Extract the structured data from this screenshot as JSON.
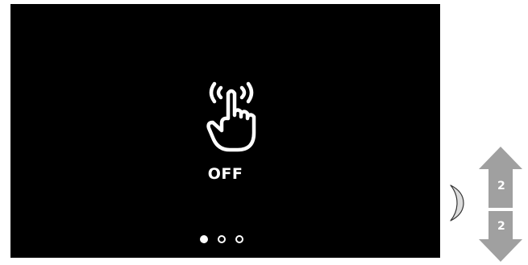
{
  "screen": {
    "status": "OFF",
    "icon": "touch-hand-icon",
    "pager": {
      "total": 3,
      "active_index": 0
    }
  },
  "nav": {
    "up_label": "2",
    "down_label": "2",
    "arrow_color": "#a0a0a0"
  },
  "colors": {
    "screen_background": "#000000",
    "foreground": "#ffffff"
  }
}
